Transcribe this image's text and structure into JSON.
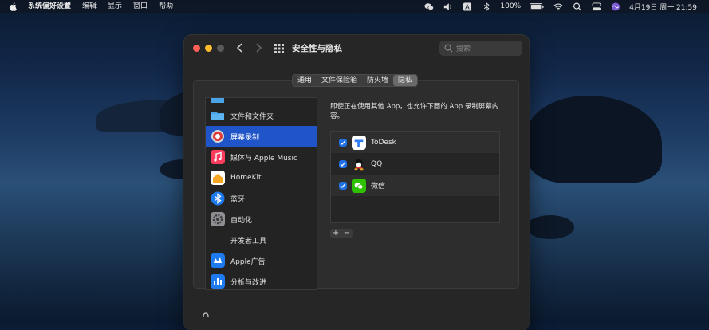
{
  "menubar": {
    "app_name": "系统偏好设置",
    "menus": [
      "编辑",
      "显示",
      "窗口",
      "帮助"
    ],
    "battery": "100%",
    "datetime": "4月19日 周一  21:59"
  },
  "window": {
    "title": "安全性与隐私",
    "search_placeholder": "搜索",
    "tabs": [
      "通用",
      "文件保险箱",
      "防火墙",
      "隐私"
    ],
    "active_tab": "隐私"
  },
  "sidebar": {
    "items": [
      {
        "label": "",
        "icon": "folder-icon",
        "partial": true
      },
      {
        "label": "文件和文件夹",
        "icon": "folder-icon"
      },
      {
        "label": "屏幕录制",
        "icon": "screen-record-icon",
        "selected": true
      },
      {
        "label": "媒体与 Apple Music",
        "icon": "music-icon"
      },
      {
        "label": "HomeKit",
        "icon": "home-icon"
      },
      {
        "label": "蓝牙",
        "icon": "bluetooth-icon"
      },
      {
        "label": "自动化",
        "icon": "gear-icon"
      },
      {
        "label": "开发者工具",
        "icon": ""
      },
      {
        "label": "Apple广告",
        "icon": "ads-icon"
      },
      {
        "label": "分析与改进",
        "icon": "analytics-icon"
      }
    ]
  },
  "main": {
    "description": "即使正在使用其他 App，也允许下面的 App 录制屏幕内容。",
    "apps": [
      {
        "name": "ToDesk",
        "checked": true,
        "icon": "todesk-icon"
      },
      {
        "name": "QQ",
        "checked": true,
        "icon": "qq-icon"
      },
      {
        "name": "微信",
        "checked": true,
        "icon": "wechat-icon"
      }
    ],
    "add_label": "+",
    "remove_label": "−"
  }
}
